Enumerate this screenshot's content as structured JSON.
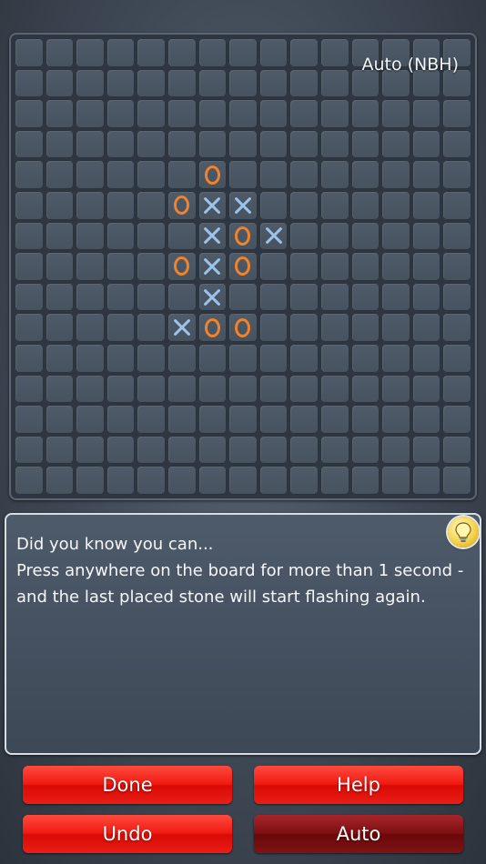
{
  "board": {
    "size": 15,
    "mode_label": "Auto (NBH)",
    "stones": [
      {
        "row": 4,
        "col": 6,
        "mark": "O"
      },
      {
        "row": 5,
        "col": 5,
        "mark": "O"
      },
      {
        "row": 5,
        "col": 6,
        "mark": "X"
      },
      {
        "row": 5,
        "col": 7,
        "mark": "X"
      },
      {
        "row": 6,
        "col": 6,
        "mark": "X"
      },
      {
        "row": 6,
        "col": 7,
        "mark": "O"
      },
      {
        "row": 6,
        "col": 8,
        "mark": "X"
      },
      {
        "row": 7,
        "col": 5,
        "mark": "O"
      },
      {
        "row": 7,
        "col": 6,
        "mark": "X"
      },
      {
        "row": 7,
        "col": 7,
        "mark": "O"
      },
      {
        "row": 8,
        "col": 6,
        "mark": "X"
      },
      {
        "row": 9,
        "col": 5,
        "mark": "X"
      },
      {
        "row": 9,
        "col": 6,
        "mark": "O"
      },
      {
        "row": 9,
        "col": 7,
        "mark": "O"
      }
    ],
    "colors": {
      "o": "#f0832b",
      "x": "#9cc3ea"
    }
  },
  "tip": {
    "lines": [
      "Did you know you can...",
      "Press anywhere on the board for more than 1 second -",
      "and the last placed stone will start flashing again."
    ],
    "icon": "lightbulb-icon"
  },
  "buttons": {
    "done": "Done",
    "help": "Help",
    "undo": "Undo",
    "auto": "Auto"
  }
}
